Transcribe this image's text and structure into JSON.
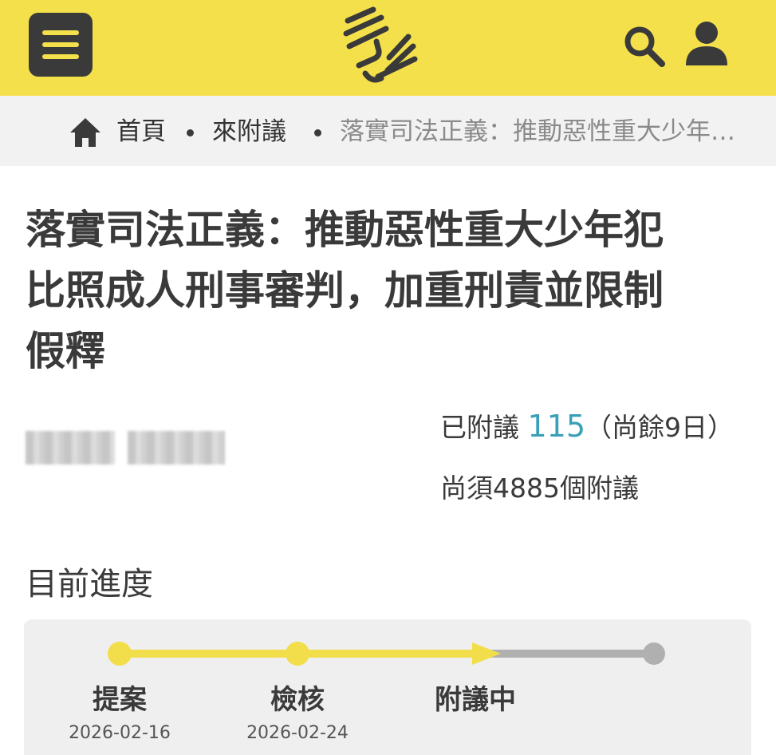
{
  "header": {
    "menu_icon": "hamburger-menu-icon",
    "logo_icon": "hand-logo-icon",
    "search_icon": "search-icon",
    "user_icon": "user-icon",
    "brand_color": "#f4e04b"
  },
  "breadcrumb": {
    "home_icon": "home-icon",
    "items": [
      {
        "label": "首頁"
      },
      {
        "label": "來附議"
      }
    ],
    "current": "落實司法正義：推動惡性重大少年犯比照成人刑事審判，加重刑責並限制假釋"
  },
  "petition": {
    "title": "落實司法正義：推動惡性重大少年犯比照成人刑事審判，加重刑責並限制假釋",
    "signed_label": "已附議",
    "signed_count": "115",
    "days_left": "（尚餘9日）",
    "remaining": "尚須4885個附議",
    "accent_color": "#3aa0b8"
  },
  "progress": {
    "heading": "目前進度",
    "active_color": "#f2de4a",
    "inactive_color": "#b0b0b0",
    "current_stage": 2,
    "stages": [
      {
        "label": "提案",
        "date": "2026-02-16"
      },
      {
        "label": "檢核",
        "date": "2026-02-24"
      },
      {
        "label": "附議中",
        "date": ""
      }
    ]
  }
}
